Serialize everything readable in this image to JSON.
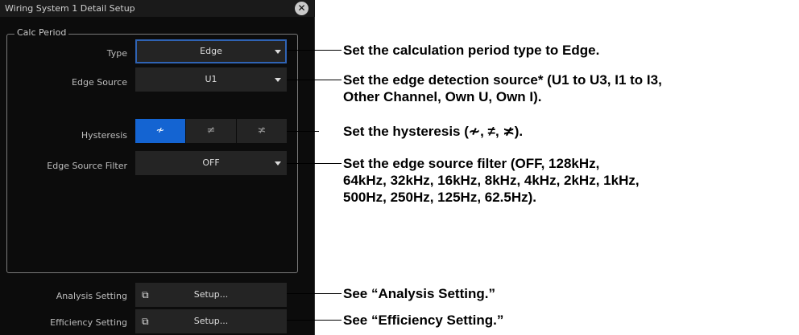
{
  "dialog": {
    "title": "Wiring System 1 Detail Setup",
    "close_symbol": "✕",
    "group_label": "Calc Period",
    "type": {
      "label": "Type",
      "value": "Edge"
    },
    "edge_source": {
      "label": "Edge Source",
      "value": "U1"
    },
    "hysteresis": {
      "label": "Hysteresis",
      "options": [
        "≁",
        "≠",
        "≭"
      ],
      "selected_index": 0
    },
    "edge_source_filter": {
      "label": "Edge Source Filter",
      "value": "OFF"
    },
    "analysis_setting": {
      "label": "Analysis Setting",
      "button": "Setup..."
    },
    "efficiency_setting": {
      "label": "Efficiency Setting",
      "button": "Setup..."
    },
    "setup_icon": "setup-window-icon"
  },
  "annotations": {
    "type_note": "Set the calculation period type to Edge.",
    "edge_source_note_1": "Set the edge detection source* (U1 to U3, I1 to I3,",
    "edge_source_note_2": "Other Channel, Own U, Own I).",
    "hysteresis_note": "Set the hysteresis (",
    "hysteresis_symbols": [
      "≁",
      "≠",
      "≭"
    ],
    "hysteresis_sep": ",",
    "hysteresis_end": ").",
    "filter_note_1": "Set the edge source filter (OFF, 128kHz,",
    "filter_note_2": "64kHz, 32kHz, 16kHz, 8kHz, 4kHz, 2kHz, 1kHz,",
    "filter_note_3": "500Hz, 250Hz, 125Hz, 62.5Hz).",
    "analysis_note": "See “Analysis Setting.”",
    "efficiency_note": "See “Efficiency Setting.”"
  },
  "colors": {
    "accent": "#1464d2",
    "focus_border": "#2f63b4",
    "panel_bg": "#0c0c0c",
    "control_bg": "#242424"
  }
}
